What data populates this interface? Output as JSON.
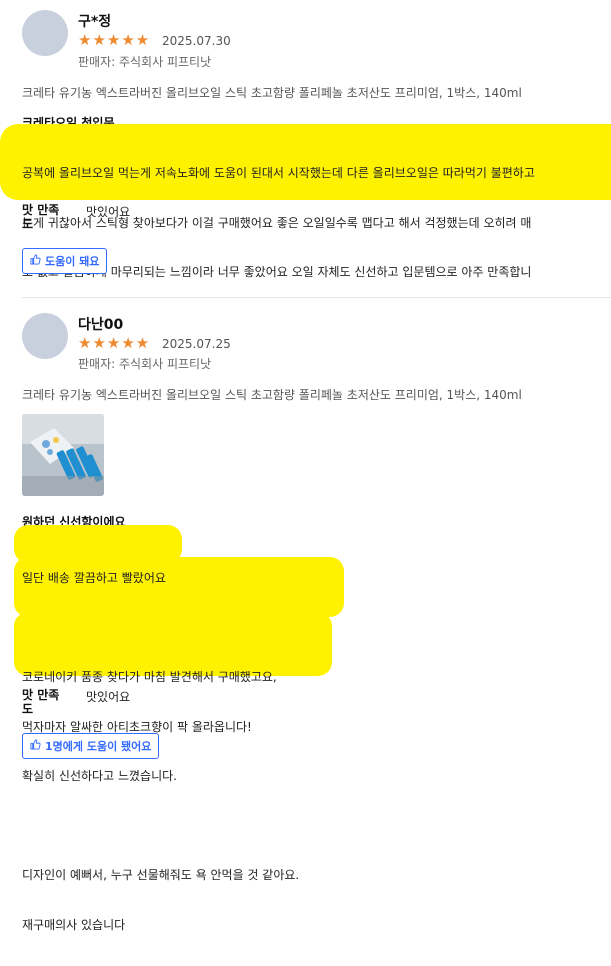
{
  "reviews": [
    {
      "name": "구*정",
      "stars": "★★★★★",
      "date": "2025.07.30",
      "seller": "판매자: 주식회사 피프티낫",
      "product": "크레타 유기농 엑스트라버진 올리브오일 스틱 초고함량 폴리페놀 초저산도 프리미엄, 1박스, 140ml",
      "headline": "크레타오일 첫입문",
      "body": [
        "공복에 올리브오일 먹는게 저속노화에 도움이 된대서 시작했는데 다른 올리브오일은 따라먹기 불편하고",
        "는게 귀찮아서 스틱형 찾아보다가 이걸 구매했어요 좋은 오일일수록 맵다고 해서 걱정했는데 오히려 매",
        "도 없고 깔끔하게 마무리되는 느낌이라 너무 좋았어요 오일 자체도 신선하고 입문템으로 아주 만족합니"
      ],
      "taste_label": "맛 만족도",
      "taste_value": "맛있어요",
      "helpful": "도움이 돼요"
    },
    {
      "name": "다난00",
      "stars": "★★★★★",
      "date": "2025.07.25",
      "seller": "판매자: 주식회사 피프티낫",
      "product": "크레타 유기농 엑스트라버진 올리브오일 스틱 초고함량 폴리페놀 초저산도 프리미엄, 1박스, 140ml",
      "headline": "원하던 신선함이에요",
      "body": [
        "일단 배송 깔끔하고 빨랐어요",
        "",
        "코로네이키 품종 찾다가 마침 발견해서 구매했고요,",
        "먹자마자 알싸한 아티초크향이 팍 올라옵니다!",
        "확실히 신선하다고 느꼈습니다.",
        "",
        "디자인이 예뻐서, 누구 선물해줘도 욕 안먹을 것 같아요.",
        "재구매의사 있습니다"
      ],
      "taste_label": "맛 만족도",
      "taste_value": "맛있어요",
      "helpful": "1명에게 도움이 됐어요"
    }
  ],
  "icons": {
    "thumb": "thumbs-up-icon"
  },
  "colors": {
    "star": "#f08a30",
    "accent": "#346aff",
    "highlight": "#fff200"
  }
}
